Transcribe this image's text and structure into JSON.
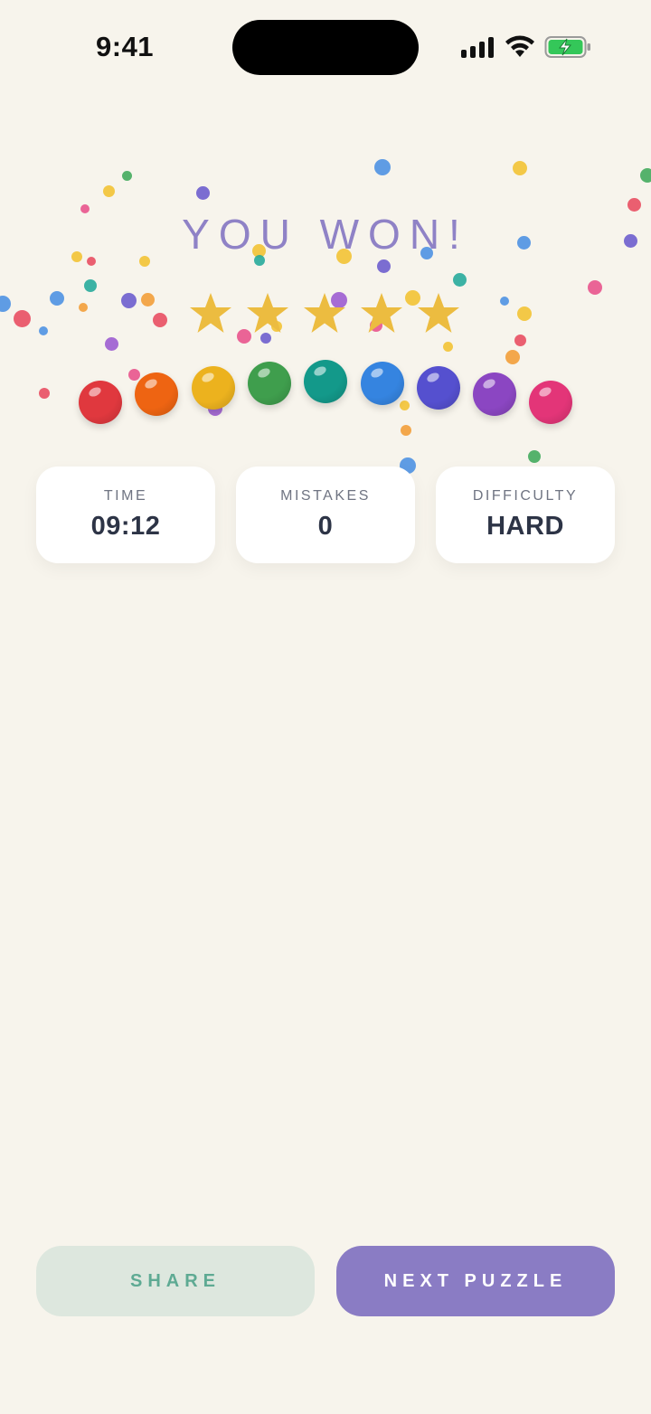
{
  "status_bar": {
    "time": "9:41",
    "icons": [
      "cellular-signal-icon",
      "wifi-icon",
      "battery-charging-icon"
    ]
  },
  "result": {
    "title": "YOU WON!",
    "stars_earned": 5,
    "stars_total": 5
  },
  "balls": {
    "colors": [
      "#e0383e",
      "#ee6412",
      "#ecb21e",
      "#3f9e4d",
      "#13998a",
      "#3584e0",
      "#5550cf",
      "#8b46c2",
      "#e33578"
    ]
  },
  "stats": [
    {
      "label": "TIME",
      "value": "09:12"
    },
    {
      "label": "MISTAKES",
      "value": "0"
    },
    {
      "label": "DIFFICULTY",
      "value": "HARD"
    }
  ],
  "actions": {
    "share_label": "SHARE",
    "next_label": "NEXT PUZZLE"
  },
  "colors": {
    "background": "#f7f4ec",
    "accent": "#8a7cc4",
    "star": "#ecbc40",
    "share_bg": "#dde7de",
    "share_text": "#5eaa93",
    "confetti": [
      "#e84a5f",
      "#f39c34",
      "#f2c230",
      "#3fa85a",
      "#22a89a",
      "#4a90e2",
      "#6a5acd",
      "#9b59d0",
      "#e8508a"
    ]
  }
}
